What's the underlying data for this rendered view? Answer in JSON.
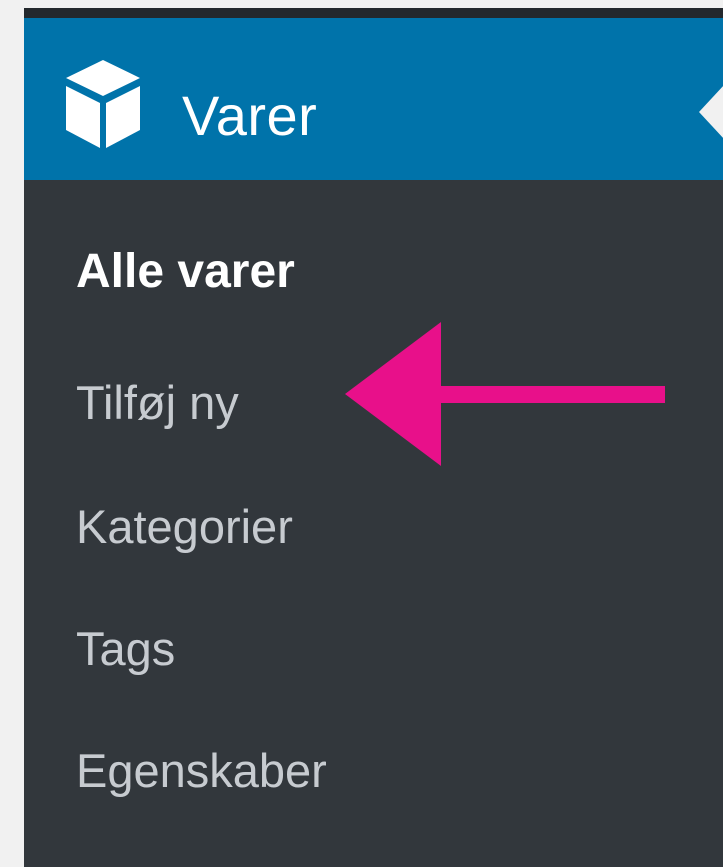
{
  "menu": {
    "title": "Varer",
    "icon": "box-icon",
    "items": [
      {
        "label": "Alle varer",
        "active": true
      },
      {
        "label": "Tilføj ny",
        "active": false
      },
      {
        "label": "Kategorier",
        "active": false
      },
      {
        "label": "Tags",
        "active": false
      },
      {
        "label": "Egenskaber",
        "active": false
      }
    ]
  },
  "colors": {
    "header_bg": "#0073aa",
    "menu_bg": "#32373c",
    "annotation": "#e8108a",
    "page_bg": "#f1f1f1"
  },
  "annotation": {
    "points_to": "Tilføj ny"
  }
}
